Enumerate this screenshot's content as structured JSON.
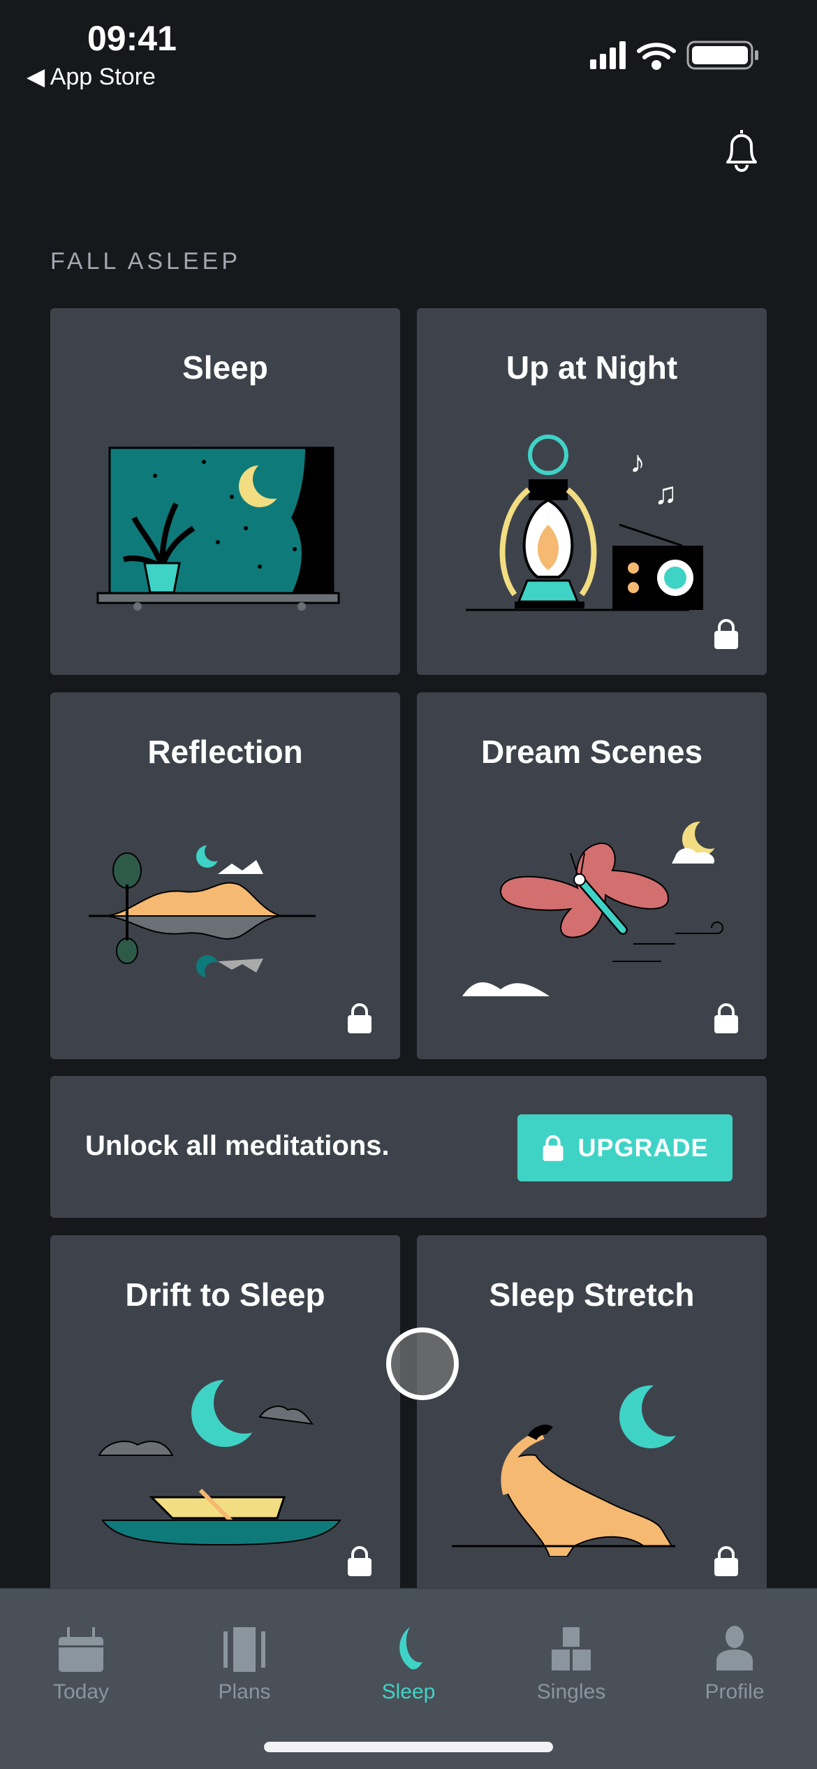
{
  "status_bar": {
    "time": "09:41",
    "back_label": "App Store"
  },
  "header": {
    "bell_icon": "bell-icon"
  },
  "section": {
    "title": "FALL ASLEEP"
  },
  "cards": [
    {
      "title": "Sleep",
      "locked": false
    },
    {
      "title": "Up at Night",
      "locked": true
    },
    {
      "title": "Reflection",
      "locked": true
    },
    {
      "title": "Dream Scenes",
      "locked": true
    },
    {
      "title": "Drift to Sleep",
      "locked": true
    },
    {
      "title": "Sleep Stretch",
      "locked": true
    }
  ],
  "banner": {
    "text": "Unlock all meditations.",
    "button_label": "UPGRADE"
  },
  "tabs": [
    {
      "label": "Today",
      "icon": "calendar-icon"
    },
    {
      "label": "Plans",
      "icon": "plans-icon"
    },
    {
      "label": "Sleep",
      "icon": "moon-icon",
      "active": true
    },
    {
      "label": "Singles",
      "icon": "blocks-icon"
    },
    {
      "label": "Profile",
      "icon": "person-icon"
    }
  ],
  "colors": {
    "accent": "#3fd3c6",
    "background": "#17181c",
    "card": "#3e434b",
    "tabbar": "#4a5058"
  }
}
